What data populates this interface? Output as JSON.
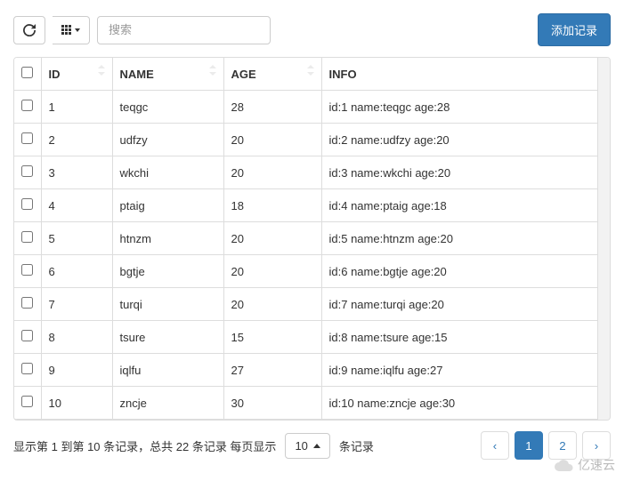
{
  "toolbar": {
    "search_placeholder": "搜索",
    "add_button": "添加记录"
  },
  "columns": {
    "id": "ID",
    "name": "NAME",
    "age": "AGE",
    "info": "INFO"
  },
  "rows": [
    {
      "id": "1",
      "name": "teqgc",
      "age": "28",
      "info": "id:1 name:teqgc age:28"
    },
    {
      "id": "2",
      "name": "udfzy",
      "age": "20",
      "info": "id:2 name:udfzy age:20"
    },
    {
      "id": "3",
      "name": "wkchi",
      "age": "20",
      "info": "id:3 name:wkchi age:20"
    },
    {
      "id": "4",
      "name": "ptaig",
      "age": "18",
      "info": "id:4 name:ptaig age:18"
    },
    {
      "id": "5",
      "name": "htnzm",
      "age": "20",
      "info": "id:5 name:htnzm age:20"
    },
    {
      "id": "6",
      "name": "bgtje",
      "age": "20",
      "info": "id:6 name:bgtje age:20"
    },
    {
      "id": "7",
      "name": "turqi",
      "age": "20",
      "info": "id:7 name:turqi age:20"
    },
    {
      "id": "8",
      "name": "tsure",
      "age": "15",
      "info": "id:8 name:tsure age:15"
    },
    {
      "id": "9",
      "name": "iqlfu",
      "age": "27",
      "info": "id:9 name:iqlfu age:27"
    },
    {
      "id": "10",
      "name": "zncje",
      "age": "30",
      "info": "id:10 name:zncje age:30"
    }
  ],
  "footer": {
    "summary_pre": "显示第 1 到第 10 条记录，总共 22 条记录 每页显示",
    "page_size": "10",
    "summary_post": "条记录",
    "prev": "‹",
    "page1": "1",
    "page2": "2",
    "next": "›"
  },
  "watermark": "亿速云"
}
